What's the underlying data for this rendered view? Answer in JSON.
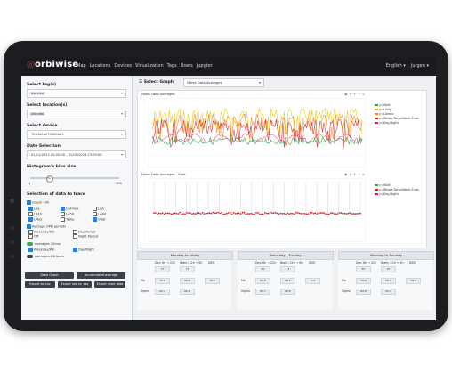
{
  "nav": {
    "logo": "orbiwise",
    "items": [
      "Map",
      "Locations",
      "Devices",
      "Visualization",
      "Tags",
      "Users",
      "Jupyter"
    ],
    "language": "English ▾",
    "user": "Jurgen ▾"
  },
  "sidebar": {
    "tags_label": "Select tag(s)",
    "tags_chip": "#orvital",
    "location_label": "Select location(s)",
    "location_chip": "#orvital",
    "device_label": "Select device",
    "device_value": "70b3d5b070000b63",
    "date_label": "Date Selection",
    "date_value": "01/12/2023 00:00:00 - 31/01/2023 23:59:00",
    "histogram_label": "Histogram's bins size",
    "histogram_min": "1",
    "histogram_value": "30",
    "histogram_max": "100",
    "trace_label": "Selection of data to trace",
    "graph_all": "Graph - All",
    "checks": [
      "Leq",
      "LAFmax",
      "LA5",
      "LA10",
      "LA50",
      "LA90",
      "LMax",
      "Temp",
      "VBat"
    ],
    "avg_label": "Average OPN periods",
    "avg_items": [
      "Weekday/WE",
      "Day Period",
      "Off",
      "Night Period"
    ],
    "avg15_label": "Averages 15min",
    "avg15_items": [
      "Weekday/WE",
      "Day/Night"
    ],
    "avg24_label": "Averages 24Hours",
    "btn_draw": "Draw Graph",
    "btn_accum": "Accumulated average",
    "btn_csv": "Export to .csv",
    "btn_raw": "Export raw to .csv",
    "btn_chart": "Export chart data"
  },
  "main": {
    "select_graph_label": "Select Graph",
    "select_graph_value": "Noise Data Averages",
    "chart1_title": "Noise Data Averages",
    "chart2_title": "Noise Data Averages - Vbat",
    "chart1_legend": [
      "y=Vbat",
      "y=LAeq",
      "y=LAmax",
      "y=Whole Days/Week Ends",
      "y=Day/Night"
    ],
    "chart2_legend": [
      "y=Vbat",
      "y=Whole Days/Week Ends",
      "y=Day/Night"
    ]
  },
  "tables": [
    {
      "title": "Monday to Friday",
      "cols": [
        "Day: 6h → 22h",
        "Night: 22h → 6h",
        "DEN"
      ],
      "rows": [
        {
          "label": "",
          "vals": [
            "77",
            "71",
            ""
          ]
        },
        {
          "label": "Mo",
          "vals": [
            "75.0",
            "69.6",
            "78.2"
          ]
        },
        {
          "label": "Sigma",
          "vals": [
            "62.4",
            "60.6",
            ""
          ]
        }
      ]
    },
    {
      "title": "Saturday - Sunday",
      "cols": [
        "Day: 6h → 22h",
        "Night: 22h → 6h",
        "DEN"
      ],
      "rows": [
        {
          "label": "",
          "vals": [
            "20",
            "23",
            ""
          ]
        },
        {
          "label": "Mo",
          "vals": [
            "81.8",
            "83.0",
            "1.4"
          ]
        },
        {
          "label": "Sigma",
          "vals": [
            "85.7",
            "80.6",
            ""
          ]
        }
      ]
    },
    {
      "title": "Monday to Sunday",
      "cols": [
        "Day: 6h → 22h",
        "Night: 22h → 6h",
        "DEN"
      ],
      "rows": [
        {
          "label": "",
          "vals": [
            "87",
            "97",
            ""
          ]
        },
        {
          "label": "Mo",
          "vals": [
            "76.0",
            "69.5",
            "78.4"
          ]
        },
        {
          "label": "Sigma",
          "vals": [
            "82.6",
            "65.4",
            ""
          ]
        }
      ]
    }
  ],
  "colors": {
    "nav": "#191b1f",
    "accent": "#d8332b",
    "yellow": "#f2c500",
    "orange": "#f08a1c",
    "red": "#d91f26",
    "green": "#2da84a",
    "pink": "#e0245e"
  }
}
